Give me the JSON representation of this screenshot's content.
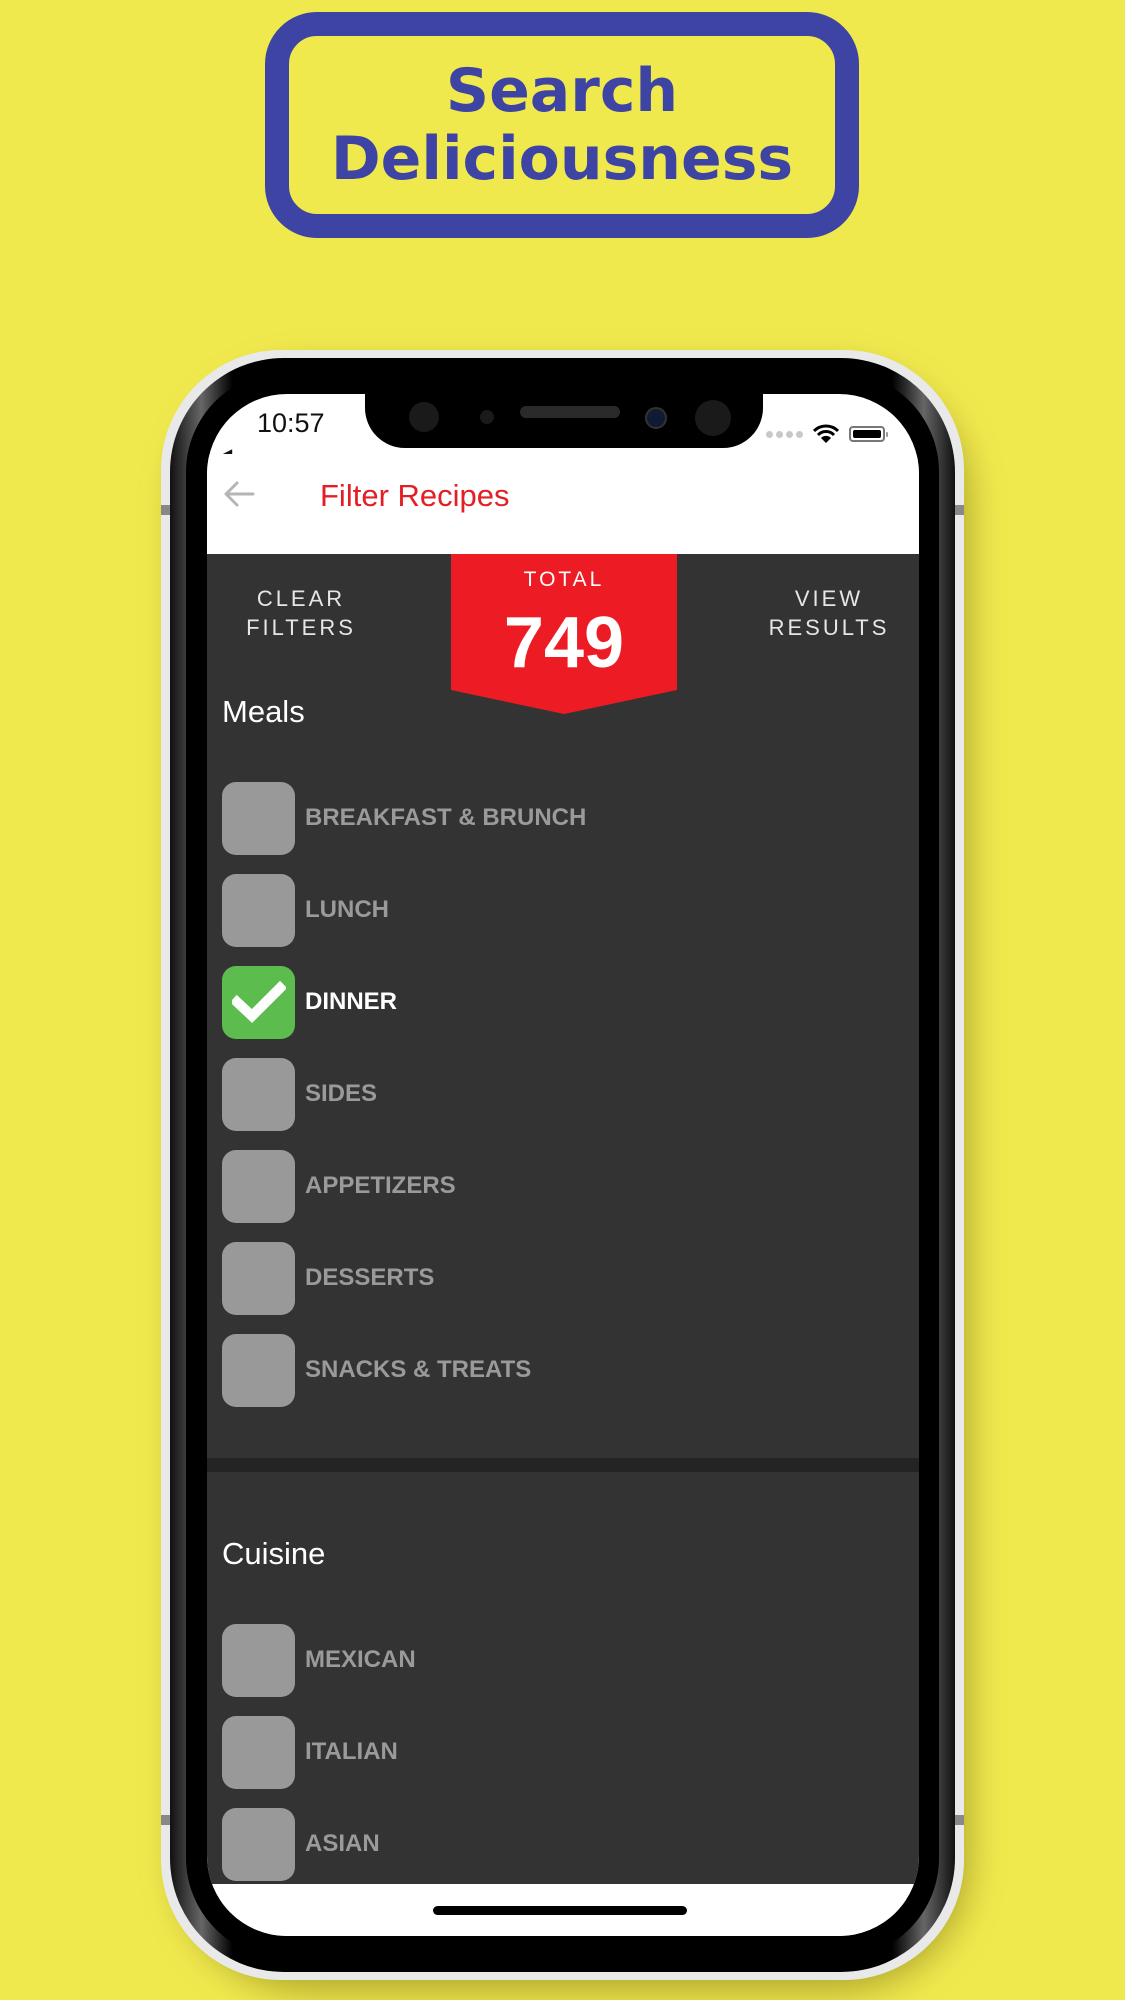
{
  "promo": {
    "line1": "Search",
    "line2": "Deliciousness",
    "color": "#3d44a3",
    "background": "#f0e94e"
  },
  "status_bar": {
    "time": "10:57",
    "back_indicator": "◀",
    "signal_icon": "signal-dots-icon",
    "wifi_icon": "wifi-icon",
    "battery_icon": "battery-icon"
  },
  "app_bar": {
    "back_icon": "arrow-left-icon",
    "title": "Filter Recipes",
    "title_color": "#e31e24"
  },
  "actions": {
    "clear_filters": "CLEAR FILTERS",
    "view_results": "VIEW RESULTS"
  },
  "total": {
    "label": "TOTAL",
    "value": "749",
    "badge_color": "#ed1c24"
  },
  "sections": [
    {
      "title": "Meals",
      "options": [
        {
          "label": "BREAKFAST & BRUNCH",
          "checked": false
        },
        {
          "label": "LUNCH",
          "checked": false
        },
        {
          "label": "DINNER",
          "checked": true
        },
        {
          "label": "SIDES",
          "checked": false
        },
        {
          "label": "APPETIZERS",
          "checked": false
        },
        {
          "label": "DESSERTS",
          "checked": false
        },
        {
          "label": "SNACKS & TREATS",
          "checked": false
        }
      ]
    },
    {
      "title": "Cuisine",
      "options": [
        {
          "label": "MEXICAN",
          "checked": false
        },
        {
          "label": "ITALIAN",
          "checked": false
        },
        {
          "label": "ASIAN",
          "checked": false
        }
      ]
    }
  ],
  "colors": {
    "checked": "#5cbc4e",
    "unchecked": "#999999",
    "panel": "#333333"
  }
}
